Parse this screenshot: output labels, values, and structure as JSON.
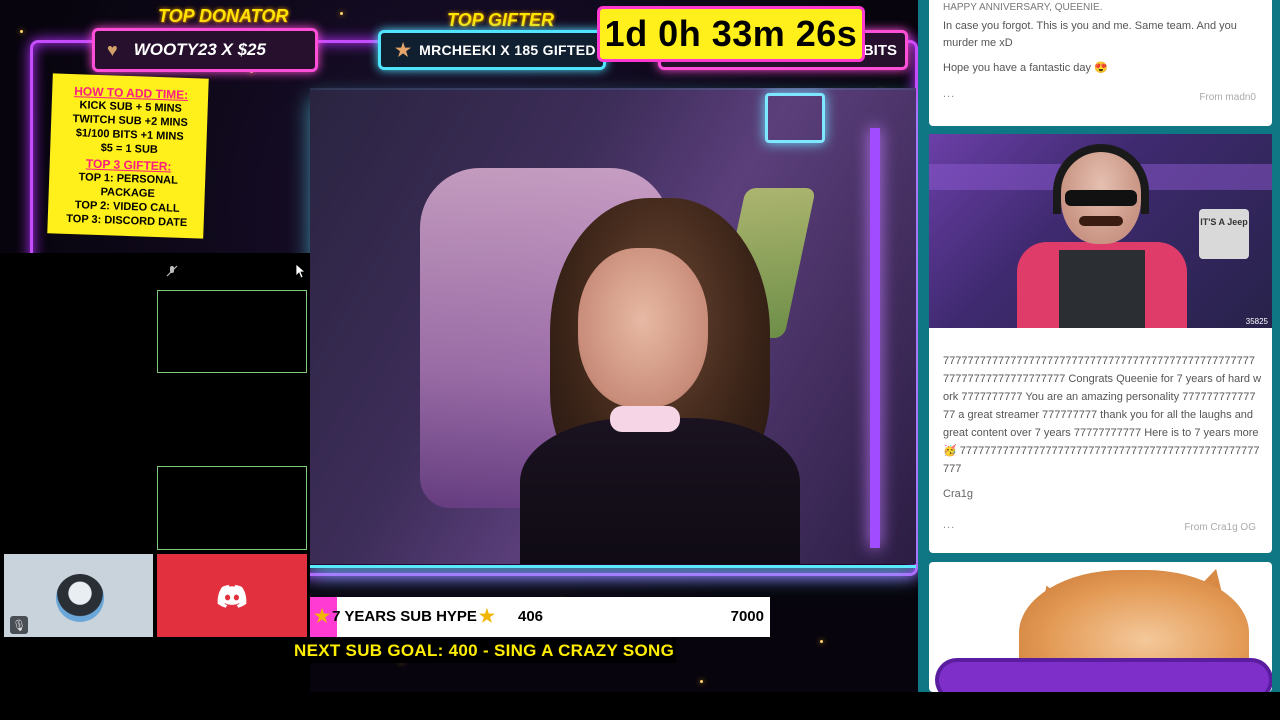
{
  "overlay": {
    "top_donator_title": "TOP DONATOR",
    "top_donator_value": "WOOTY23 X $25",
    "top_gifter_title": "TOP GIFTER",
    "top_gifter_value": "MRCHEEKI X 185 GIFTED",
    "bits_label": "BITS",
    "timer": "1d 0h 33m 26s",
    "info_card": {
      "heading": "HOW TO ADD TIME:",
      "lines": [
        "KICK SUB + 5 MINS",
        "TWITCH SUB +2 MINS",
        "$1/100 BITS  +1 MINS",
        "$5 = 1 SUB"
      ],
      "heading2": "TOP 3 GIFTER:",
      "rewards": [
        "TOP 1: PERSONAL PACKAGE",
        "TOP 2: VIDEO CALL",
        "TOP 3: DISCORD DATE"
      ]
    },
    "hype": {
      "label": "7 YEARS SUB HYPE",
      "current": "406",
      "goal": "7000",
      "progress_fraction": 0.058
    },
    "next_goal": "NEXT SUB GOAL:  400 - SING A CRAZY SONG"
  },
  "feed": {
    "card1": {
      "cut_line": "HAPPY ANNIVERSARY, QUEENIE.",
      "line1": "In case you forgot. This is you and me. Same team. And you murder me xD",
      "line2": "Hope you have a fantastic day 😍",
      "more": "...",
      "from": "From madn0"
    },
    "card2": {
      "count": "35825",
      "sign_text": "IT'S A Jeep",
      "message": "77777777777777777777777777777777777777777777777777777777777777777777777 Congrats Queenie for 7 years of hard work 7777777777 You are an amazing personality 77777777777777 a great streamer 777777777 thank you for all the laughs and great content over 7 years 77777777777 Here is to 7 years more 🥳 7777777777777777777777777777777777777777777777777777",
      "signature": "Cra1g",
      "more": "...",
      "from": "From Cra1g OG"
    }
  },
  "colors": {
    "neon_pink": "#ff4fd8",
    "neon_cyan": "#4fe5ff",
    "timer_yellow": "#ffef1a",
    "discord_red": "#e3303f",
    "feed_bg": "#0f7684"
  }
}
